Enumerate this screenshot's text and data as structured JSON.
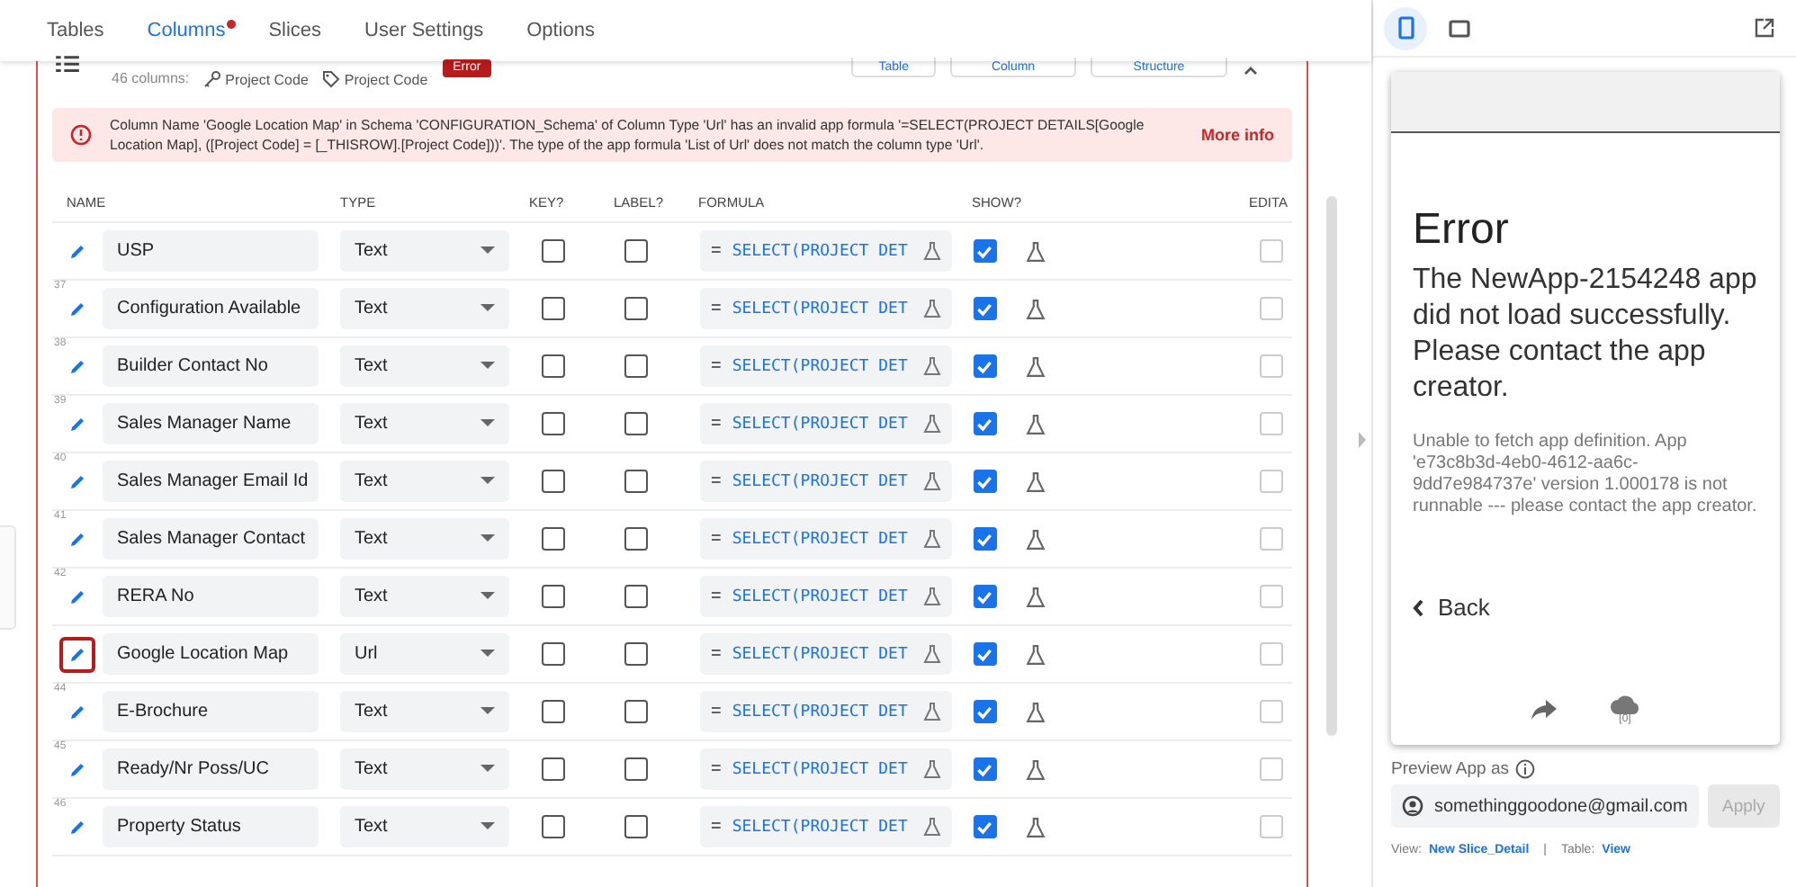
{
  "tabs": [
    {
      "label": "Tables",
      "selected": false,
      "alert": false
    },
    {
      "label": "Columns",
      "selected": true,
      "alert": true
    },
    {
      "label": "Slices",
      "selected": false,
      "alert": false
    },
    {
      "label": "User Settings",
      "selected": false,
      "alert": false
    },
    {
      "label": "Options",
      "selected": false,
      "alert": false
    }
  ],
  "toolbar": {
    "column_count": "46 columns:",
    "key_column": "Project Code",
    "label_column": "Project Code",
    "status_badge": "Error",
    "buttons": [
      "Table",
      "Column",
      "Structure"
    ]
  },
  "error_banner": {
    "message": "Column Name 'Google Location Map' in Schema 'CONFIGURATION_Schema' of Column Type 'Url' has an invalid app formula '=SELECT(PROJECT DETAILS[Google Location Map], ([Project Code] = [_THISROW].[Project Code]))'. The type of the app formula 'List of Url' does not match the column type 'Url'.",
    "link": "More info"
  },
  "table": {
    "columns": [
      "NAME",
      "TYPE",
      "KEY?",
      "LABEL?",
      "FORMULA",
      "SHOW?",
      "EDITA"
    ],
    "rows": [
      {
        "name": "USP",
        "type": "Text",
        "key": false,
        "label": false,
        "formula_prefix": "=",
        "formula": "SELECT(PROJECT DET",
        "show": true,
        "editable": false,
        "selected": false
      },
      {
        "number": "37",
        "name": "Configuration Available",
        "type": "Text",
        "key": false,
        "label": false,
        "formula_prefix": "=",
        "formula": "SELECT(PROJECT DET",
        "show": true,
        "editable": false,
        "selected": false
      },
      {
        "number": "38",
        "name": "Builder Contact No",
        "type": "Text",
        "key": false,
        "label": false,
        "formula_prefix": "=",
        "formula": "SELECT(PROJECT DET",
        "show": true,
        "editable": false,
        "selected": false
      },
      {
        "number": "39",
        "name": "Sales Manager Name",
        "type": "Text",
        "key": false,
        "label": false,
        "formula_prefix": "=",
        "formula": "SELECT(PROJECT DET",
        "show": true,
        "editable": false,
        "selected": false
      },
      {
        "number": "40",
        "name": "Sales Manager Email Id",
        "type": "Text",
        "key": false,
        "label": false,
        "formula_prefix": "=",
        "formula": "SELECT(PROJECT DET",
        "show": true,
        "editable": false,
        "selected": false
      },
      {
        "number": "41",
        "name": "Sales Manager Contact",
        "type": "Text",
        "key": false,
        "label": false,
        "formula_prefix": "=",
        "formula": "SELECT(PROJECT DET",
        "show": true,
        "editable": false,
        "selected": false
      },
      {
        "number": "42",
        "name": "RERA No",
        "type": "Text",
        "key": false,
        "label": false,
        "formula_prefix": "=",
        "formula": "SELECT(PROJECT DET",
        "show": true,
        "editable": false,
        "selected": false
      },
      {
        "name": "Google Location Map",
        "type": "Url",
        "key": false,
        "label": false,
        "formula_prefix": "=",
        "formula": "SELECT(PROJECT DET",
        "show": true,
        "editable": false,
        "selected": true
      },
      {
        "number": "44",
        "name": "E-Brochure",
        "type": "Text",
        "key": false,
        "label": false,
        "formula_prefix": "=",
        "formula": "SELECT(PROJECT DET",
        "show": true,
        "editable": false,
        "selected": false
      },
      {
        "number": "45",
        "name": "Ready/Nr Poss/UC",
        "type": "Text",
        "key": false,
        "label": false,
        "formula_prefix": "=",
        "formula": "SELECT(PROJECT DET",
        "show": true,
        "editable": false,
        "selected": false
      },
      {
        "number": "46",
        "name": "Property Status",
        "type": "Text",
        "key": false,
        "label": false,
        "formula_prefix": "=",
        "formula": "SELECT(PROJECT DET",
        "show": true,
        "editable": false,
        "selected": false
      }
    ]
  },
  "preview": {
    "devices": [
      {
        "kind": "phone",
        "selected": true
      },
      {
        "kind": "tablet",
        "selected": false
      }
    ],
    "title": "Error",
    "message": "The NewApp-2154248 app did not load successfully. Please contact the app creator.",
    "detail": "Unable to fetch app definition. App 'e73c8b3d-4eb0-4612-aa6c-9dd7e984737e' version 1.000178 is not runnable --- please contact the app creator.",
    "back": "Back",
    "sync_count": "[0]",
    "preview_as_label": "Preview App as",
    "user_email": "somethinggoodone@gmail.com",
    "apply_button": "Apply",
    "view_label": "View:",
    "view_link": "New Slice_Detail",
    "separator": "|",
    "table_label": "Table:",
    "table_link": "View"
  }
}
